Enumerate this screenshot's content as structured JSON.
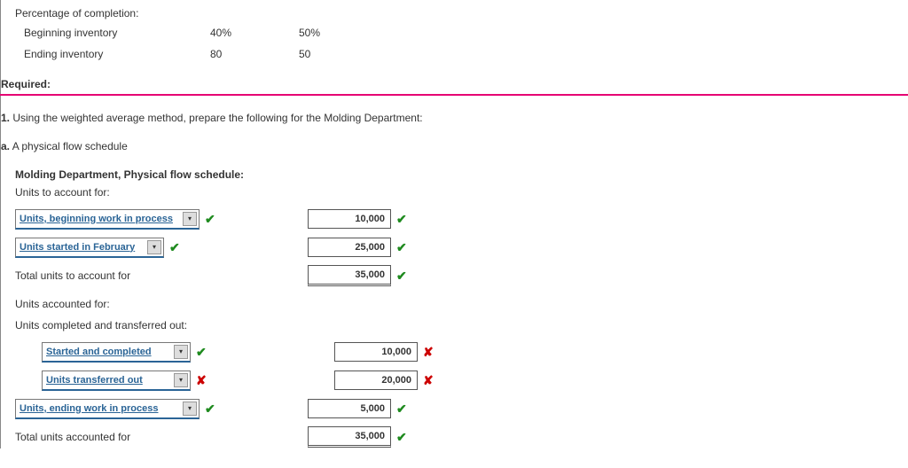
{
  "pct": {
    "title": "Percentage of completion:",
    "rows": [
      {
        "label": "Beginning inventory",
        "c1": "40%",
        "c2": "50%"
      },
      {
        "label": "Ending inventory",
        "c1": "80",
        "c2": "50"
      }
    ]
  },
  "required_label": "Required:",
  "q1_prefix": "1.",
  "q1_text": " Using the weighted average method, prepare the following for the Molding Department:",
  "qa_prefix": "a.",
  "qa_text": " A physical flow schedule",
  "schedule": {
    "title": "Molding Department, Physical flow schedule:",
    "units_to_account_for": "Units to account for:",
    "line1": {
      "dropdown": "Units, beginning work in process",
      "dd_mark": "check",
      "value": "10,000",
      "val_mark": "check"
    },
    "line2": {
      "dropdown": "Units started in February",
      "dd_mark": "check",
      "value": "25,000",
      "val_mark": "check"
    },
    "total1": {
      "label": "Total units to account for",
      "value": "35,000",
      "val_mark": "check"
    },
    "units_accounted_for": "Units accounted for:",
    "units_completed_out": "Units completed and transferred out:",
    "line3": {
      "dropdown": "Started and completed",
      "dd_mark": "check",
      "value": "10,000",
      "val_mark": "cross"
    },
    "line4": {
      "dropdown": "Units transferred out",
      "dd_mark": "cross",
      "value": "20,000",
      "val_mark": "cross"
    },
    "line5": {
      "dropdown": "Units, ending work in process",
      "dd_mark": "check",
      "value": "5,000",
      "val_mark": "check"
    },
    "total2": {
      "label": "Total units accounted for",
      "value": "35,000",
      "val_mark": "check"
    }
  },
  "marks": {
    "check": "✔",
    "cross": "✘"
  },
  "arrow": "▾"
}
